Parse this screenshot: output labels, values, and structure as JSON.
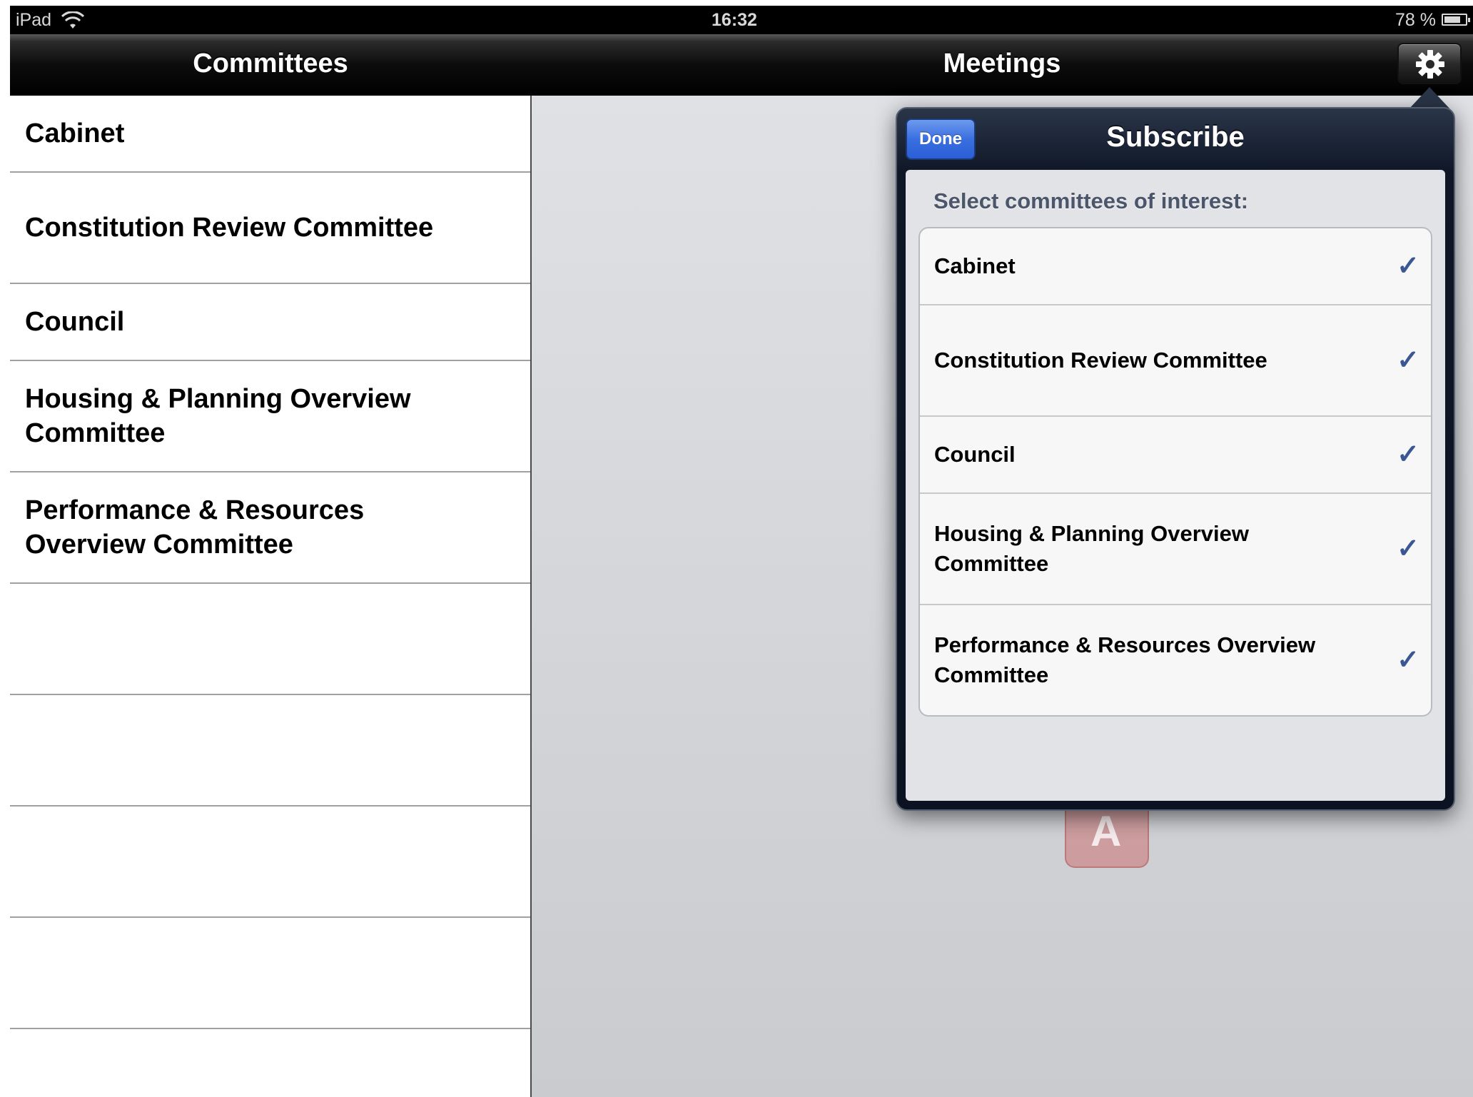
{
  "status_bar": {
    "carrier": "iPad",
    "time": "16:32",
    "battery_percent": "78 %"
  },
  "master": {
    "title": "Committees",
    "items": [
      {
        "label": "Cabinet"
      },
      {
        "label": "Constitution Review Committee"
      },
      {
        "label": "Council"
      },
      {
        "label": "Housing & Planning Overview Committee"
      },
      {
        "label": "Performance & Resources Overview Committee"
      }
    ]
  },
  "detail": {
    "title": "Meetings",
    "settings_icon": "gear-icon"
  },
  "popover": {
    "title": "Subscribe",
    "done_label": "Done",
    "section_header": "Select committees of interest:",
    "options": [
      {
        "label": "Cabinet",
        "check": "✓"
      },
      {
        "label": "Constitution Review Committee",
        "check": "✓"
      },
      {
        "label": "Council",
        "check": "✓"
      },
      {
        "label": "Housing & Planning Overview Committee",
        "check": "✓"
      },
      {
        "label": "Performance & Resources Overview Committee",
        "check": "✓"
      }
    ],
    "checkmark_color": "#3a5793",
    "done_color": "#3a6fe0"
  }
}
